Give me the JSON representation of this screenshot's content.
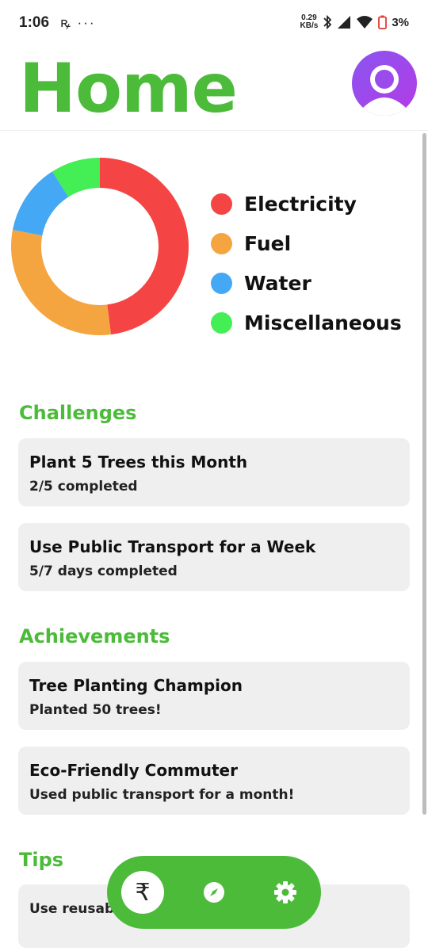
{
  "status_bar": {
    "time": "1:06",
    "left_icons": "ꝶ ···",
    "net_speed_value": "0.29",
    "net_speed_unit": "KB/s",
    "battery": "3%"
  },
  "header": {
    "title": "Home",
    "avatar_icon": "person-icon"
  },
  "colors": {
    "accent": "#4CBB3A",
    "card_bg": "#EFEFEF",
    "avatar_gradient": [
      "#8A55F0",
      "#B33BE6"
    ]
  },
  "chart_data": {
    "type": "pie",
    "categories": [
      "Electricity",
      "Fuel",
      "Water",
      "Miscellaneous"
    ],
    "values": [
      48,
      30,
      13,
      9
    ],
    "colors": [
      "#F44444",
      "#F4A540",
      "#44A8F4",
      "#44EE55"
    ],
    "legend_position": "right",
    "title": ""
  },
  "challenges": {
    "title": "Challenges",
    "items": [
      {
        "title": "Plant 5 Trees this Month",
        "subtitle": "2/5 completed"
      },
      {
        "title": "Use Public Transport for a Week",
        "subtitle": "5/7 days completed"
      }
    ]
  },
  "achievements": {
    "title": "Achievements",
    "items": [
      {
        "title": "Tree Planting Champion",
        "subtitle": "Planted 50 trees!"
      },
      {
        "title": "Eco-Friendly Commuter",
        "subtitle": "Used public transport for a month!"
      }
    ]
  },
  "tips": {
    "title": "Tips",
    "items": [
      {
        "text": "Use reusab...ace plastic waste."
      }
    ]
  },
  "bottom_nav": {
    "items": [
      {
        "icon": "rupee-icon",
        "glyph": "₹",
        "active": true
      },
      {
        "icon": "compass-icon",
        "active": false
      },
      {
        "icon": "gear-icon",
        "active": false
      }
    ]
  }
}
